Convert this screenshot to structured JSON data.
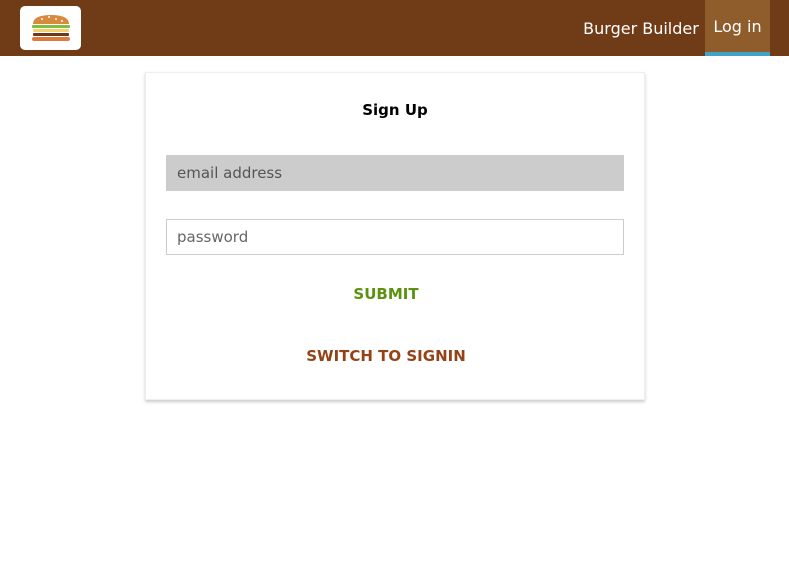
{
  "header": {
    "logo_icon": "burger-icon",
    "nav": [
      {
        "label": "Burger Builder",
        "active": false
      },
      {
        "label": "Log in",
        "active": true
      }
    ]
  },
  "form": {
    "title": "Sign Up",
    "email_placeholder": "email address",
    "password_placeholder": "password",
    "submit_label": "SUBMIT",
    "switch_label": "SWITCH TO SIGNIN"
  },
  "colors": {
    "toolbar_bg": "#703b17",
    "active_nav_bg": "#8f5c2c",
    "active_nav_underline": "#40a4c8",
    "submit": "#5c9210",
    "switch": "#944317"
  }
}
